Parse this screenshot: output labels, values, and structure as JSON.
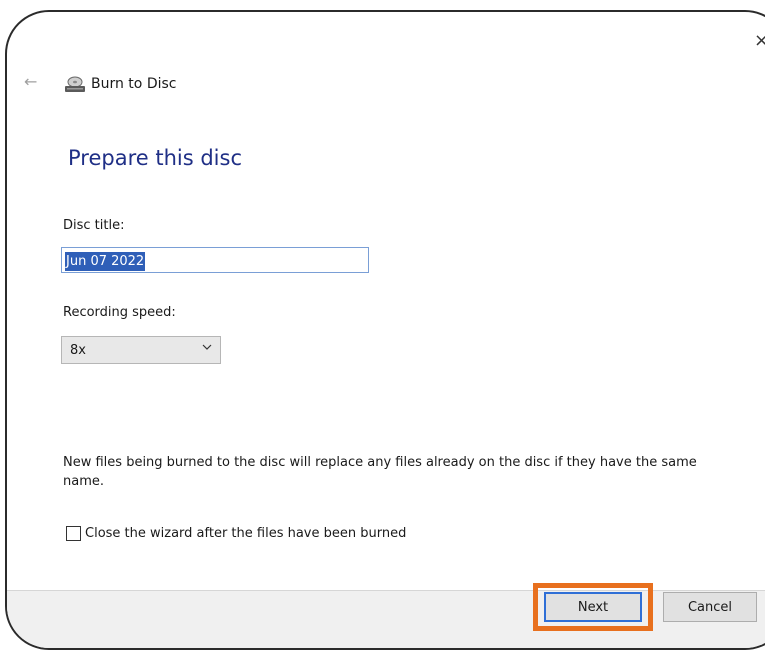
{
  "window": {
    "title": "Burn to Disc",
    "close_glyph": "×",
    "back_glyph": "←"
  },
  "page": {
    "heading": "Prepare this disc"
  },
  "disc_title": {
    "label": "Disc title:",
    "value": "Jun 07 2022"
  },
  "recording_speed": {
    "label": "Recording speed:",
    "selected": "8x"
  },
  "info_text": "New files being burned to the disc will replace any files already on the disc if they have the same name.",
  "close_wizard": {
    "label": "Close the wizard after the files have been burned",
    "checked": false
  },
  "buttons": {
    "next": "Next",
    "cancel": "Cancel"
  },
  "colors": {
    "heading": "#1f2f86",
    "selection": "#2f5fb8",
    "highlight": "#e8701e",
    "focus_border": "#2f6fd6"
  },
  "icons": {
    "back": "back-arrow-icon",
    "title": "disc-burner-icon",
    "close": "close-icon",
    "dropdown": "chevron-down-icon"
  }
}
